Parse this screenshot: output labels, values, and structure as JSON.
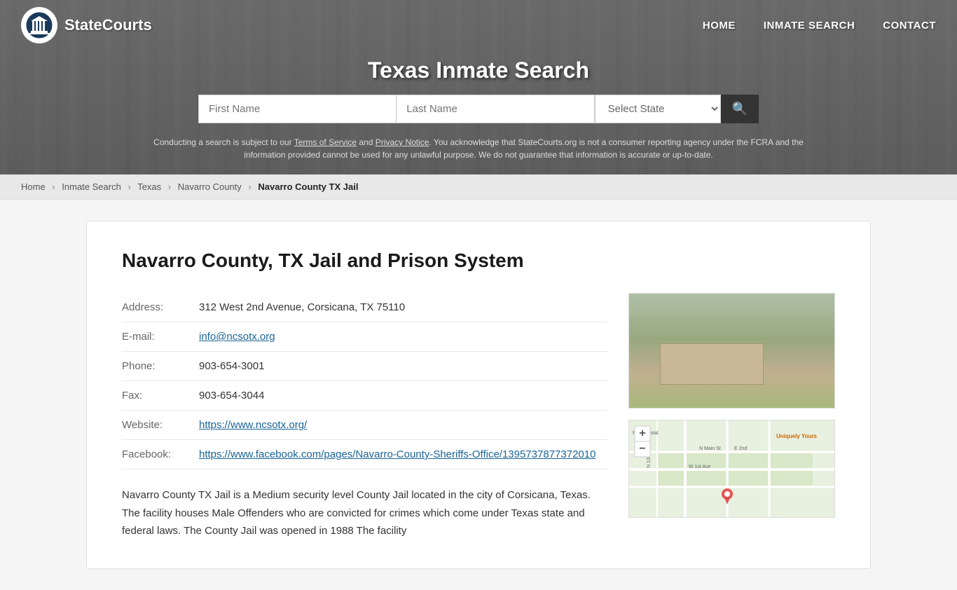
{
  "site": {
    "name": "StateCourts",
    "logo_alt": "StateCourts logo"
  },
  "nav": {
    "home_label": "HOME",
    "inmate_search_label": "INMATE SEARCH",
    "contact_label": "CONTACT"
  },
  "header": {
    "title": "Texas Inmate Search",
    "search": {
      "first_name_placeholder": "First Name",
      "last_name_placeholder": "Last Name",
      "state_placeholder": "Select State",
      "search_btn_icon": "🔍"
    },
    "disclaimer": "Conducting a search is subject to our Terms of Service and Privacy Notice. You acknowledge that StateCourts.org is not a consumer reporting agency under the FCRA and the information provided cannot be used for any unlawful purpose. We do not guarantee that information is accurate or up-to-date."
  },
  "breadcrumb": {
    "items": [
      "Home",
      "Inmate Search",
      "Texas",
      "Navarro County"
    ],
    "current": "Navarro County TX Jail"
  },
  "facility": {
    "heading": "Navarro County, TX Jail and Prison System",
    "address_label": "Address:",
    "address_value": "312 West 2nd Avenue, Corsicana, TX 75110",
    "email_label": "E-mail:",
    "email_value": "info@ncsotx.org",
    "phone_label": "Phone:",
    "phone_value": "903-654-3001",
    "fax_label": "Fax:",
    "fax_value": "903-654-3044",
    "website_label": "Website:",
    "website_value": "https://www.ncsotx.org/",
    "facebook_label": "Facebook:",
    "facebook_value": "https://www.facebook.com/pages/Navarro-County-Sheriffs-Office/1395737877372010",
    "description": "Navarro County TX Jail is a Medium security level County Jail located in the city of Corsicana, Texas. The facility houses Male Offenders who are convicted for crimes which come under Texas state and federal laws. The County Jail was opened in 1988 The facility"
  }
}
